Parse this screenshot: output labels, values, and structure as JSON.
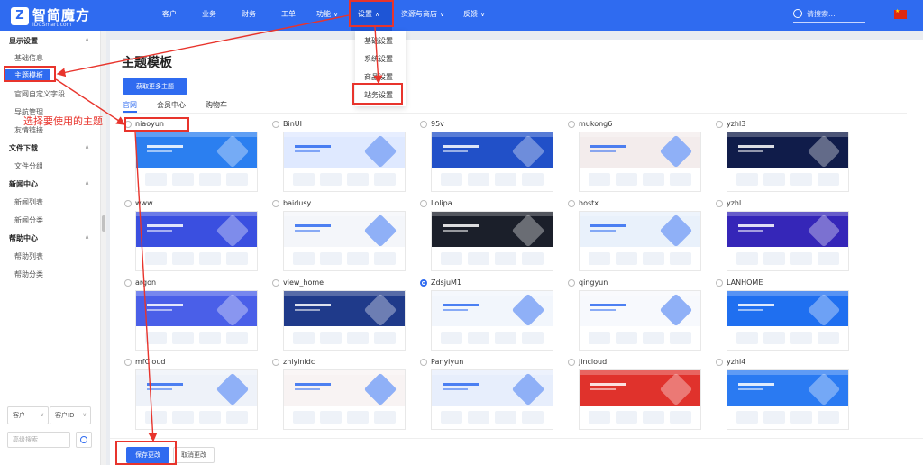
{
  "topbar": {
    "logo_cn": "智简魔方",
    "logo_en": "IDCSmart.com",
    "nav": [
      {
        "label": "客户"
      },
      {
        "label": "业务"
      },
      {
        "label": "财务"
      },
      {
        "label": "工单"
      },
      {
        "label": "功能"
      },
      {
        "label": "设置"
      },
      {
        "label": "资源与商店"
      },
      {
        "label": "反馈"
      }
    ],
    "search_placeholder": "请搜索...",
    "accent": "#2f6bf0"
  },
  "dropdown": {
    "items": [
      {
        "label": "基础设置"
      },
      {
        "label": "系统设置"
      },
      {
        "label": "商品设置"
      },
      {
        "label": "站务设置"
      }
    ]
  },
  "sidebar": {
    "groups": [
      {
        "label": "显示设置",
        "items": [
          {
            "label": "基础信息"
          },
          {
            "label": "主题模板"
          },
          {
            "label": "官网自定义字段"
          },
          {
            "label": "导航管理"
          },
          {
            "label": "友情链接"
          }
        ]
      },
      {
        "label": "文件下载",
        "items": [
          {
            "label": "文件分组"
          }
        ]
      },
      {
        "label": "新闻中心",
        "items": [
          {
            "label": "新闻列表"
          },
          {
            "label": "新闻分类"
          }
        ]
      },
      {
        "label": "帮助中心",
        "items": [
          {
            "label": "帮助列表"
          },
          {
            "label": "帮助分类"
          }
        ]
      }
    ],
    "select1": "客户",
    "select2": "客户ID",
    "search_placeholder": "高级搜索"
  },
  "main": {
    "title": "主题模板",
    "get_more": "获取更多主题",
    "tabs": [
      {
        "label": "官网"
      },
      {
        "label": "会员中心"
      },
      {
        "label": "购物车"
      }
    ],
    "themes": [
      {
        "name": "niaoyun",
        "color": "#2b7ff0",
        "selected": false
      },
      {
        "name": "BinUI",
        "color": "#dfe9ff",
        "selected": false
      },
      {
        "name": "95v",
        "color": "#2150c8",
        "selected": false
      },
      {
        "name": "mukong6",
        "color": "#f3ecec",
        "selected": false
      },
      {
        "name": "yzhl3",
        "color": "#101c4a",
        "selected": false
      },
      {
        "name": "www",
        "color": "#3a4fe0",
        "selected": false
      },
      {
        "name": "baidusy",
        "color": "#f4f6fa",
        "selected": false
      },
      {
        "name": "Lolipa",
        "color": "#1b1f2a",
        "selected": false
      },
      {
        "name": "hostx",
        "color": "#e9f1fb",
        "selected": false
      },
      {
        "name": "yzhl",
        "color": "#3526b8",
        "selected": false
      },
      {
        "name": "argon",
        "color": "#4a5fe8",
        "selected": false
      },
      {
        "name": "view_home",
        "color": "#1f3a8a",
        "selected": false
      },
      {
        "name": "ZdsjuM1",
        "color": "#f2f6fc",
        "selected": true
      },
      {
        "name": "qingyun",
        "color": "#f7f9fd",
        "selected": false
      },
      {
        "name": "LANHOME",
        "color": "#1f6ff0",
        "selected": false
      },
      {
        "name": "mfCloud",
        "color": "#eef2f9",
        "selected": false
      },
      {
        "name": "zhiyinidc",
        "color": "#f8f3f3",
        "selected": false
      },
      {
        "name": "Panyiyun",
        "color": "#e7eefc",
        "selected": false
      },
      {
        "name": "jincloud",
        "color": "#e0322c",
        "selected": false
      },
      {
        "name": "yzhl4",
        "color": "#2a7af2",
        "selected": false
      }
    ],
    "save": "保存更改",
    "cancel": "取消更改"
  },
  "annotation": {
    "text": "选择要使用的主题",
    "color": "#e8342c"
  }
}
